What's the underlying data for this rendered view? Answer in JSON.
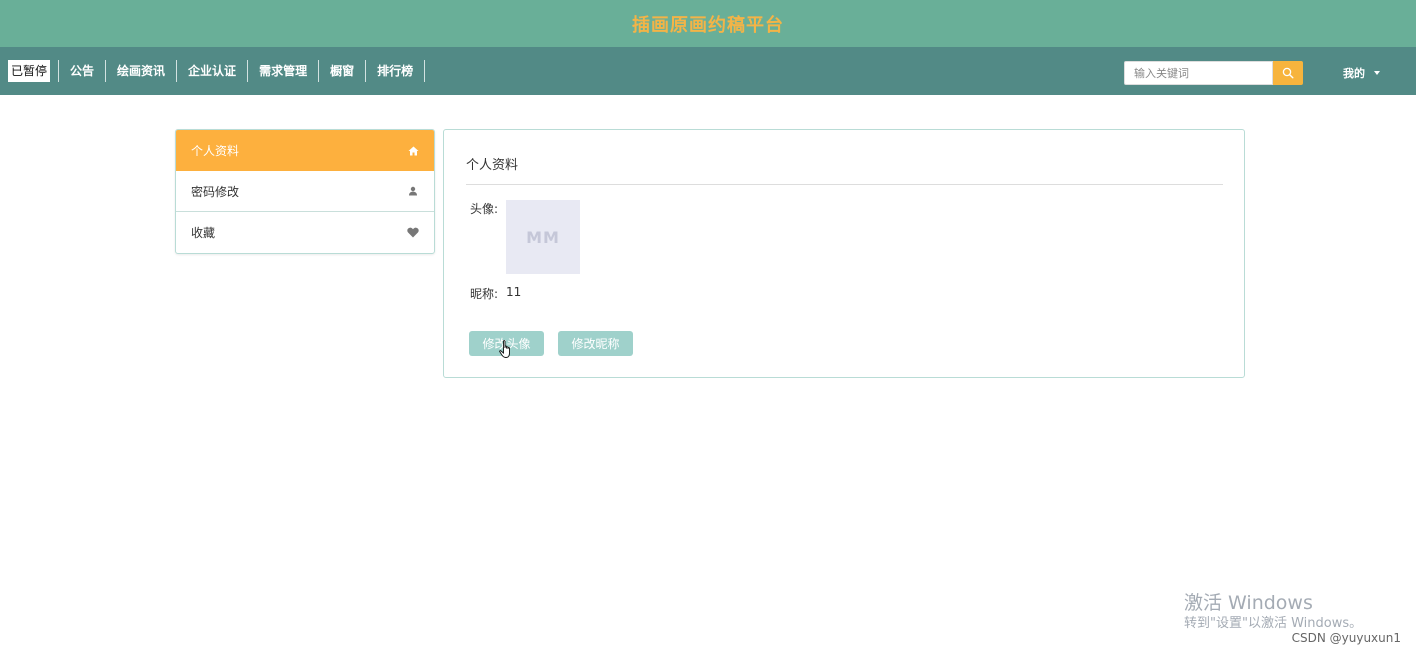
{
  "site": {
    "title": "插画原画约稿平台"
  },
  "nav": {
    "paused_label": "已暂停",
    "items": [
      {
        "label": "公告"
      },
      {
        "label": "绘画资讯"
      },
      {
        "label": "企业认证"
      },
      {
        "label": "需求管理"
      },
      {
        "label": "橱窗"
      },
      {
        "label": "排行榜"
      }
    ],
    "search_placeholder": "输入关键词",
    "me_label": "我的"
  },
  "side_menu": {
    "items": [
      {
        "label": "个人资料",
        "icon": "home-icon",
        "active": true
      },
      {
        "label": "密码修改",
        "icon": "user-icon",
        "active": false
      },
      {
        "label": "收藏",
        "icon": "heart-icon",
        "active": false
      }
    ]
  },
  "profile": {
    "title": "个人资料",
    "avatar_label": "头像:",
    "avatar_text": "MM",
    "nickname_label": "昵称:",
    "nickname_value": "11",
    "change_avatar_button": "修改头像",
    "change_nickname_button": "修改昵称"
  },
  "watermark": {
    "main": "激活 Windows",
    "sub": "转到\"设置\"以激活 Windows。"
  },
  "credit": "CSDN @yuyuxun1",
  "colors": {
    "title_bar": "#69af98",
    "nav_bar": "#528a86",
    "accent_orange": "#fdb03e",
    "button_teal": "#9fd1cb"
  }
}
